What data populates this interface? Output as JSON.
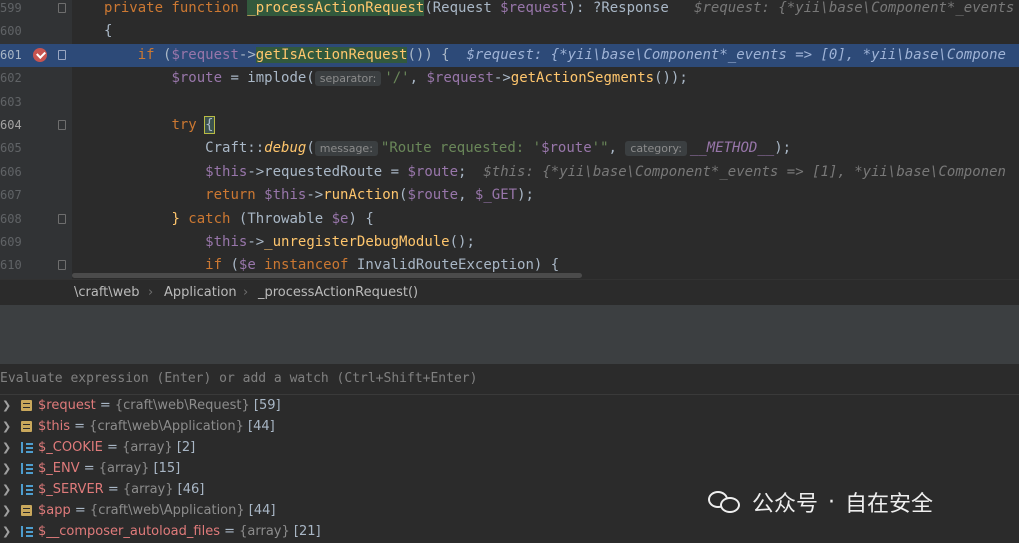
{
  "editor": {
    "lines": [
      {
        "num": "599"
      },
      {
        "num": "600"
      },
      {
        "num": "601"
      },
      {
        "num": "602"
      },
      {
        "num": "603"
      },
      {
        "num": "604"
      },
      {
        "num": "605"
      },
      {
        "num": "606"
      },
      {
        "num": "607"
      },
      {
        "num": "608"
      },
      {
        "num": "609"
      },
      {
        "num": "610"
      }
    ],
    "code": {
      "l599_kw": "private function ",
      "l599_fn": "_processActionRequest",
      "l599_params": "(Request ",
      "l599_var": "$request",
      "l599_ret": "): ?Response",
      "l599_dbg": "$request: {*yii\\base\\Component*_events",
      "l600": "{",
      "l601_kw": "if ",
      "l601_open": "(",
      "l601_var": "$request",
      "l601_arrow": "->",
      "l601_method": "getIsActionRequest",
      "l601_close": "()) {",
      "l601_dbg": "$request: {*yii\\base\\Component*_events => [0], *yii\\base\\Compone",
      "l602_var": "$route",
      "l602_eq": " = implode(",
      "l602_hint": "separator:",
      "l602_str": "'/'",
      "l602_comma": ", ",
      "l602_var2": "$request",
      "l602_arrow": "->",
      "l602_method": "getActionSegments",
      "l602_end": "());",
      "l604_kw": "try ",
      "l604_brace": "{",
      "l605_cls": "Craft::",
      "l605_fn": "debug",
      "l605_open": "(",
      "l605_hint1": "message:",
      "l605_str1": "\"Route requested: '",
      "l605_var": "$route",
      "l605_str2": "'\"",
      "l605_comma": ", ",
      "l605_hint2": "category:",
      "l605_const": "__METHOD__",
      "l605_end": ");",
      "l606_this": "$this",
      "l606_prop": "->requestedRoute = ",
      "l606_var": "$route",
      "l606_end": ";",
      "l606_dbg": "$this: {*yii\\base\\Component*_events => [1], *yii\\base\\Componen",
      "l607_kw": "return ",
      "l607_this": "$this",
      "l607_arrow": "->",
      "l607_fn": "runAction",
      "l607_open": "(",
      "l607_var": "$route",
      "l607_comma": ", ",
      "l607_get": "$_GET",
      "l607_end": ");",
      "l608_brace": "}",
      "l608_kw": " catch ",
      "l608_rest": "(Throwable ",
      "l608_var": "$e",
      "l608_end": ") {",
      "l609_this": "$this",
      "l609_arrow": "->",
      "l609_fn": "_unregisterDebugModule",
      "l609_end": "();",
      "l610_kw": "if ",
      "l610_open": "(",
      "l610_var": "$e",
      "l610_inst": " instanceof ",
      "l610_cls": "InvalidRouteException",
      "l610_end": ") {"
    }
  },
  "breadcrumb": {
    "namespace": "\\craft\\web",
    "class": "Application",
    "method": "_processActionRequest()"
  },
  "evaluate": {
    "placeholder": "Evaluate expression (Enter) or add a watch (Ctrl+Shift+Enter)"
  },
  "variables": [
    {
      "name": "$request",
      "type": "{craft\\web\\Request}",
      "value": "[59]",
      "icon": "object-icon"
    },
    {
      "name": "$this",
      "type": "{craft\\web\\Application}",
      "value": "[44]",
      "icon": "object-icon"
    },
    {
      "name": "$_COOKIE",
      "type": "{array}",
      "value": "[2]",
      "icon": "array-icon"
    },
    {
      "name": "$_ENV",
      "type": "{array}",
      "value": "[15]",
      "icon": "array-icon"
    },
    {
      "name": "$_SERVER",
      "type": "{array}",
      "value": "[46]",
      "icon": "array-icon"
    },
    {
      "name": "$app",
      "type": "{craft\\web\\Application}",
      "value": "[44]",
      "icon": "object-icon"
    },
    {
      "name": "$__composer_autoload_files",
      "type": "{array}",
      "value": "[21]",
      "icon": "array-icon"
    }
  ],
  "watermark": {
    "brand": "公众号",
    "dot": "·",
    "name": "自在安全",
    "icon": "wechat-icon"
  },
  "colors": {
    "background": "#2b2b2b",
    "highlight_line": "#2d4a78",
    "keyword": "#cc7832",
    "variable": "#9876aa",
    "function": "#ffc66d",
    "string": "#6a8759",
    "breakpoint": "#c75450",
    "var_name": "#e07b7b"
  }
}
